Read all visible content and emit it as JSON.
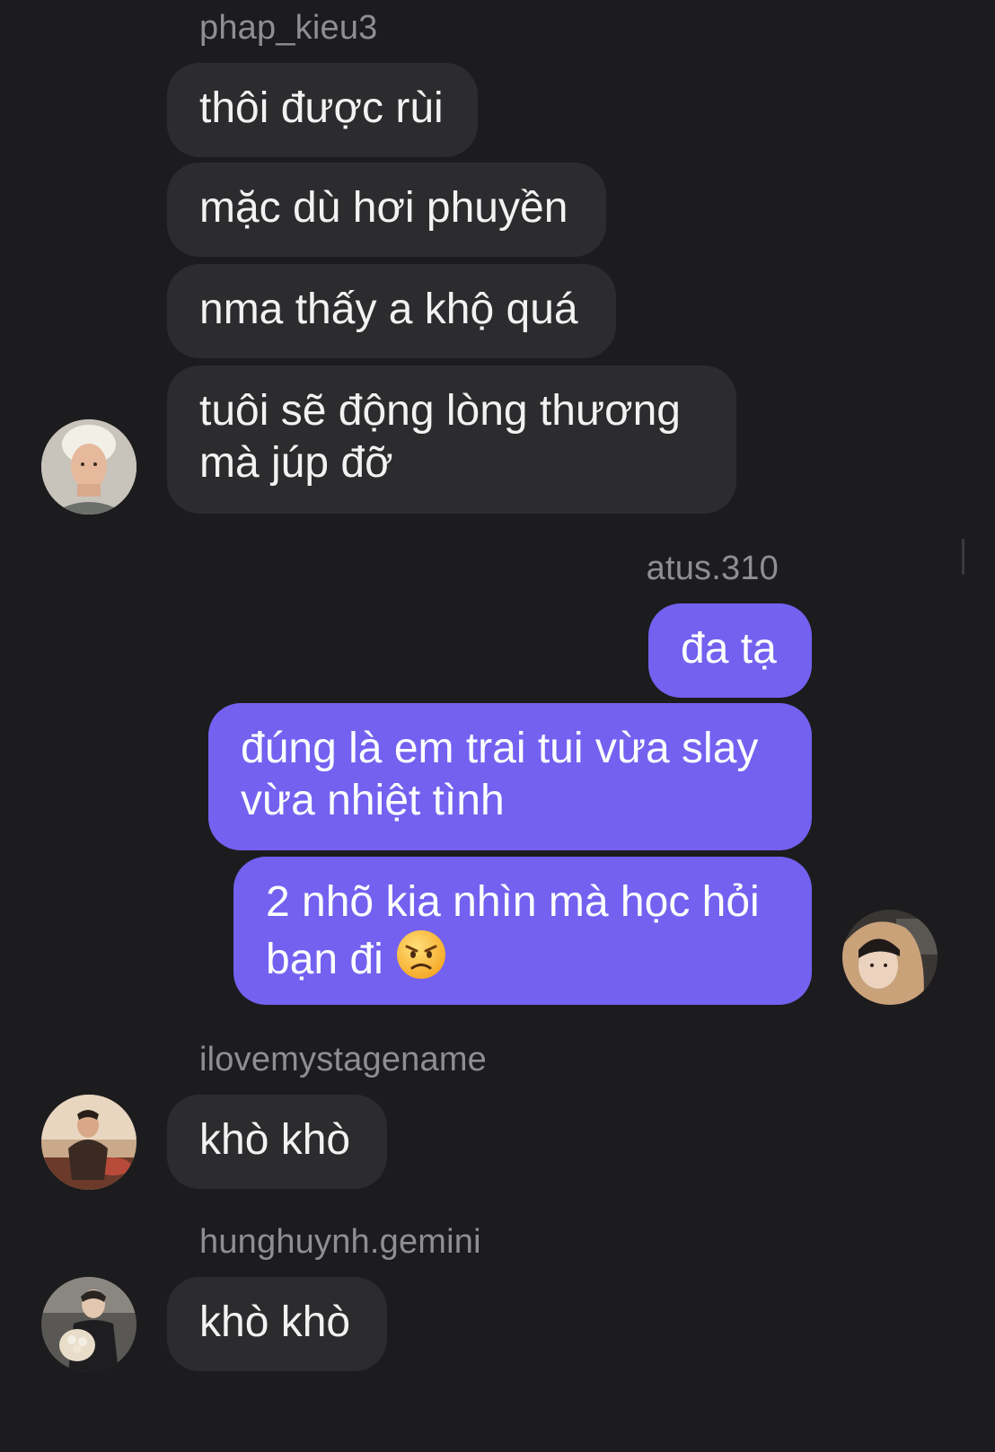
{
  "messages": [
    {
      "sender": "phap_kieu3",
      "direction": "incoming",
      "bubbles": [
        "thôi được rùi",
        "mặc dù hơi phuyền",
        "nma thấy a khộ quá"
      ],
      "last_bubble_lines": [
        "tuôi sẽ động lòng thương",
        "mà júp đỡ"
      ]
    },
    {
      "sender": "atus.310",
      "direction": "outgoing",
      "bubble1": "đa tạ",
      "bubble2_lines": [
        "đúng là em trai tui vừa slay",
        "vừa nhiệt tình"
      ],
      "bubble3_lines": [
        "2 nhõ kia nhìn mà học hỏi",
        "bạn đi"
      ],
      "bubble3_emoji": "angry-face-emoji"
    },
    {
      "sender": "ilovemystagename",
      "direction": "incoming",
      "bubble": "khò khò"
    },
    {
      "sender": "hunghuynh.gemini",
      "direction": "incoming",
      "bubble": "khò khò"
    }
  ],
  "colors": {
    "background": "#1c1c1e",
    "incoming_bubble": "#2c2c2e",
    "outgoing_bubble": "#7461f0",
    "username": "#8e8e93"
  }
}
